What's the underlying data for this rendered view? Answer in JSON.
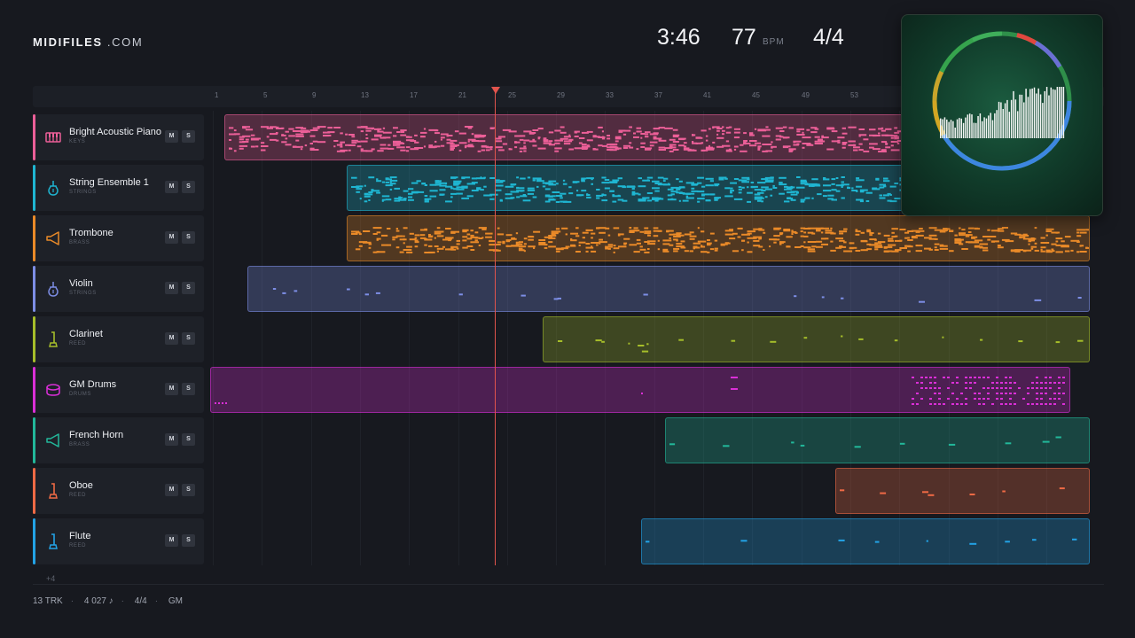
{
  "brand": {
    "name": "MIDIFILES",
    "suffix": ".COM"
  },
  "transport": {
    "time": "3:46",
    "tempo": "77",
    "tempo_unit": "BPM",
    "signature": "4/4"
  },
  "ruler": {
    "ticks": [
      "1",
      "5",
      "9",
      "13",
      "17",
      "21",
      "25",
      "29",
      "33",
      "37",
      "41",
      "45",
      "49",
      "53"
    ]
  },
  "tracks": [
    {
      "name": "Bright Acoustic Piano",
      "category": "KEYS",
      "color": "#ec5f98",
      "icon": "piano-icon",
      "mute": "M",
      "solo": "S"
    },
    {
      "name": "String Ensemble 1",
      "category": "STRINGS",
      "color": "#1fb6d2",
      "icon": "violin-icon",
      "mute": "M",
      "solo": "S"
    },
    {
      "name": "Trombone",
      "category": "BRASS",
      "color": "#ea8a28",
      "icon": "horn-icon",
      "mute": "M",
      "solo": "S"
    },
    {
      "name": "Violin",
      "category": "STRINGS",
      "color": "#7d8ee6",
      "icon": "violin-icon",
      "mute": "M",
      "solo": "S"
    },
    {
      "name": "Clarinet",
      "category": "REED",
      "color": "#a6be2a",
      "icon": "clarinet-icon",
      "mute": "M",
      "solo": "S"
    },
    {
      "name": "GM Drums",
      "category": "DRUMS",
      "color": "#db2fd8",
      "icon": "drum-icon",
      "mute": "M",
      "solo": "S"
    },
    {
      "name": "French Horn",
      "category": "BRASS",
      "color": "#22b89a",
      "icon": "horn-icon",
      "mute": "M",
      "solo": "S"
    },
    {
      "name": "Oboe",
      "category": "REED",
      "color": "#ef6a45",
      "icon": "clarinet-icon",
      "mute": "M",
      "solo": "S"
    },
    {
      "name": "Flute",
      "category": "REED",
      "color": "#23a3e6",
      "icon": "clarinet-icon",
      "mute": "M",
      "solo": "S"
    }
  ],
  "more_tracks": "+4",
  "footer": {
    "tracks": "13 TRK",
    "notes": "4 027 ♪",
    "signature": "4/4",
    "standard": "GM"
  }
}
